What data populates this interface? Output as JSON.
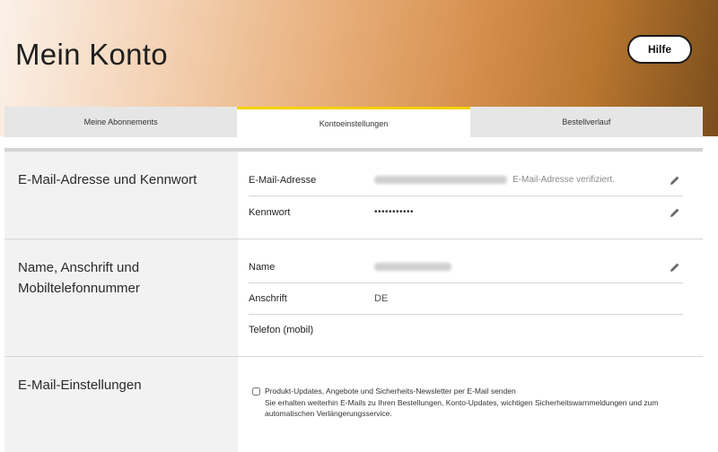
{
  "header": {
    "title": "Mein Konto",
    "help_label": "Hilfe"
  },
  "tabs": [
    {
      "label": "Meine Abonnements",
      "active": false
    },
    {
      "label": "Kontoeinstellungen",
      "active": true
    },
    {
      "label": "Bestellverlauf",
      "active": false
    }
  ],
  "sections": {
    "email_password": {
      "title": "E-Mail-Adresse und Kennwort",
      "email_label": "E-Mail-Adresse",
      "email_status": "E-Mail-Adresse verifiziert.",
      "password_label": "Kennwort",
      "password_value": "•••••••••••"
    },
    "name_address": {
      "title_line1": "Name, Anschrift und",
      "title_line2": "Mobiltelefonnummer",
      "name_label": "Name",
      "address_label": "Anschrift",
      "address_value": "DE",
      "phone_label": "Telefon (mobil)"
    },
    "email_settings": {
      "title": "E-Mail-Einstellungen",
      "newsletter_line1": "Produkt-Updates, Angebote und Sicherheits-Newsletter per E-Mail senden",
      "newsletter_line2": "Sie erhalten weiterhin E-Mails zu Ihren Bestellungen, Konto-Updates, wichtigen Sicherheitswarnmeldungen und zum",
      "newsletter_line3": "automatischen Verlängerungsservice.",
      "newsletter_checked": false
    }
  },
  "colors": {
    "tab_accent": "#f5d100",
    "left_panel": "#f2f2f2"
  },
  "icons": {
    "edit": "pencil-icon"
  }
}
